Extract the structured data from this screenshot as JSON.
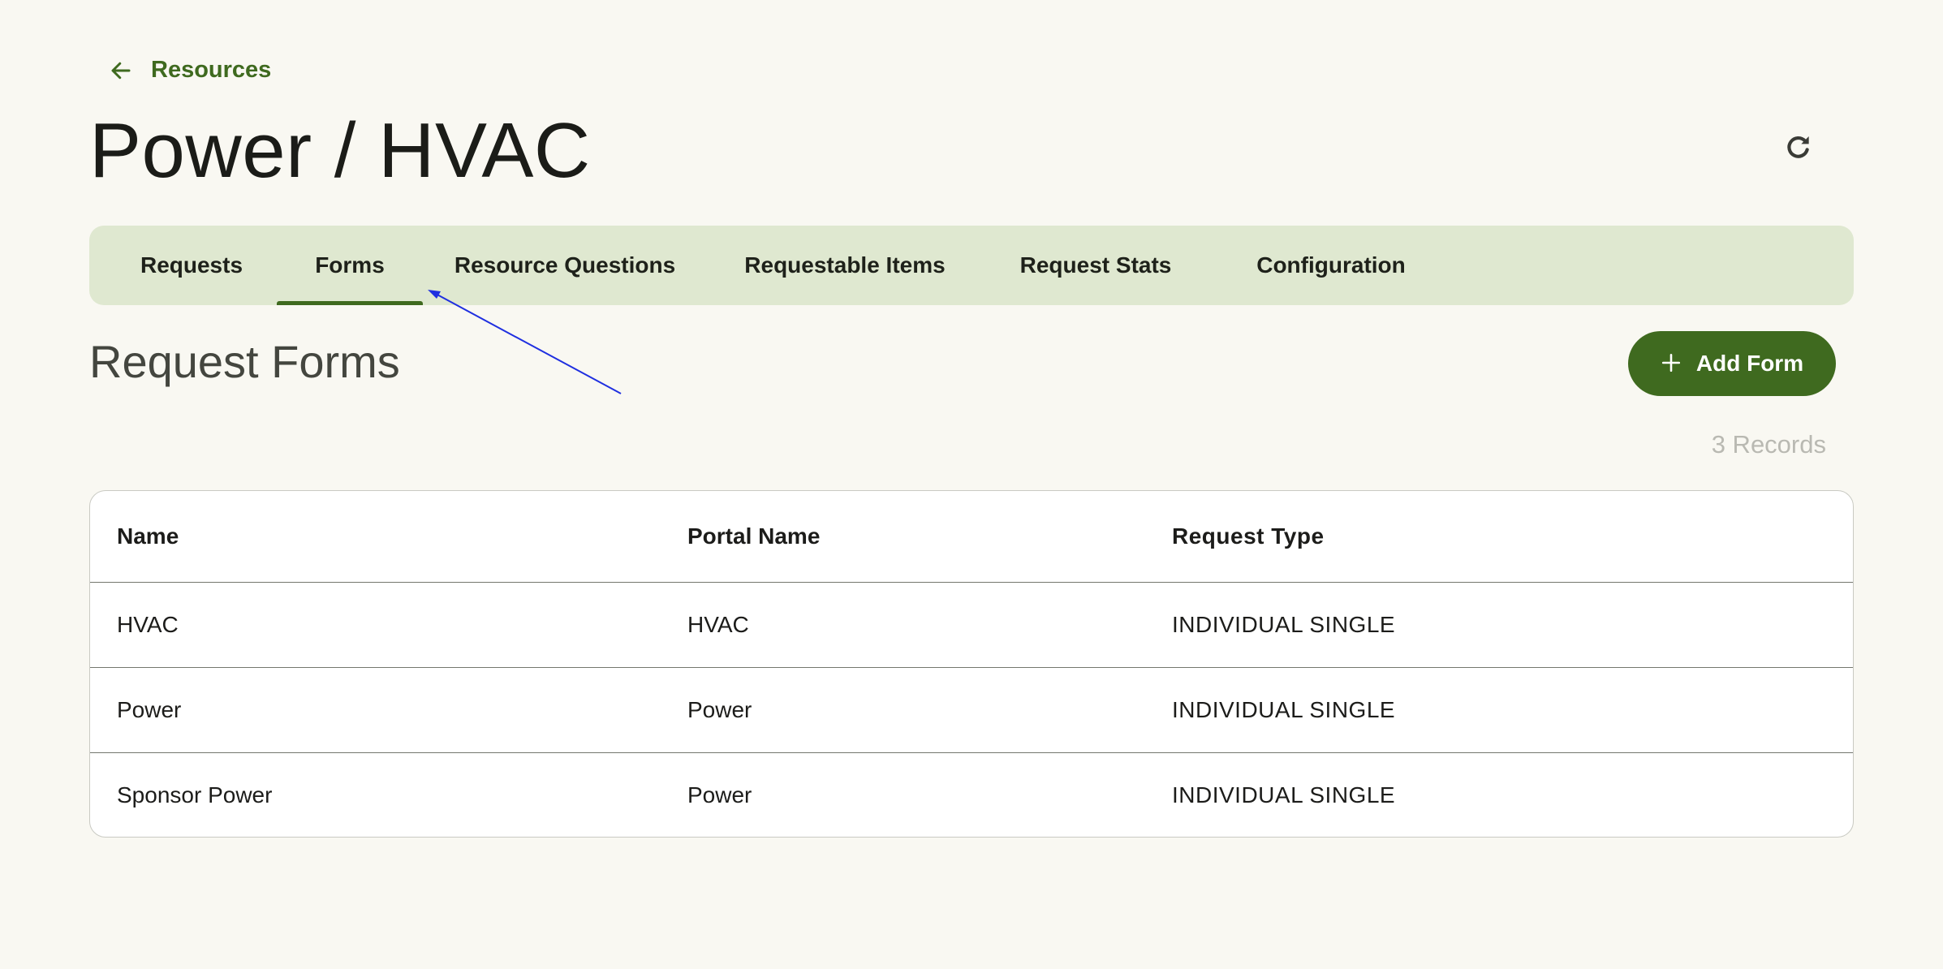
{
  "breadcrumb": {
    "back_label": "Resources",
    "icon": "arrow-left-icon"
  },
  "page": {
    "title": "Power / HVAC",
    "refresh_icon": "refresh-icon"
  },
  "tabs": [
    {
      "label": "Requests",
      "active": false
    },
    {
      "label": "Forms",
      "active": true
    },
    {
      "label": "Resource Questions",
      "active": false
    },
    {
      "label": "Requestable Items",
      "active": false
    },
    {
      "label": "Request Stats",
      "active": false
    },
    {
      "label": "Configuration",
      "active": false
    }
  ],
  "section": {
    "title": "Request Forms",
    "add_button_label": "Add Form",
    "add_button_icon": "plus-icon",
    "records_count": "3 Records"
  },
  "table": {
    "columns": [
      "Name",
      "Portal Name",
      "Request Type"
    ],
    "rows": [
      {
        "name": "HVAC",
        "portal_name": "HVAC",
        "request_type": "INDIVIDUAL SINGLE"
      },
      {
        "name": "Power",
        "portal_name": "Power",
        "request_type": "INDIVIDUAL SINGLE"
      },
      {
        "name": "Sponsor Power",
        "portal_name": "Power",
        "request_type": "INDIVIDUAL SINGLE"
      }
    ]
  },
  "colors": {
    "background": "#f9f8f2",
    "accent": "#3f6a1f",
    "tabbar": "#dfe8d0",
    "annotation_arrow": "#1f2fe0"
  }
}
